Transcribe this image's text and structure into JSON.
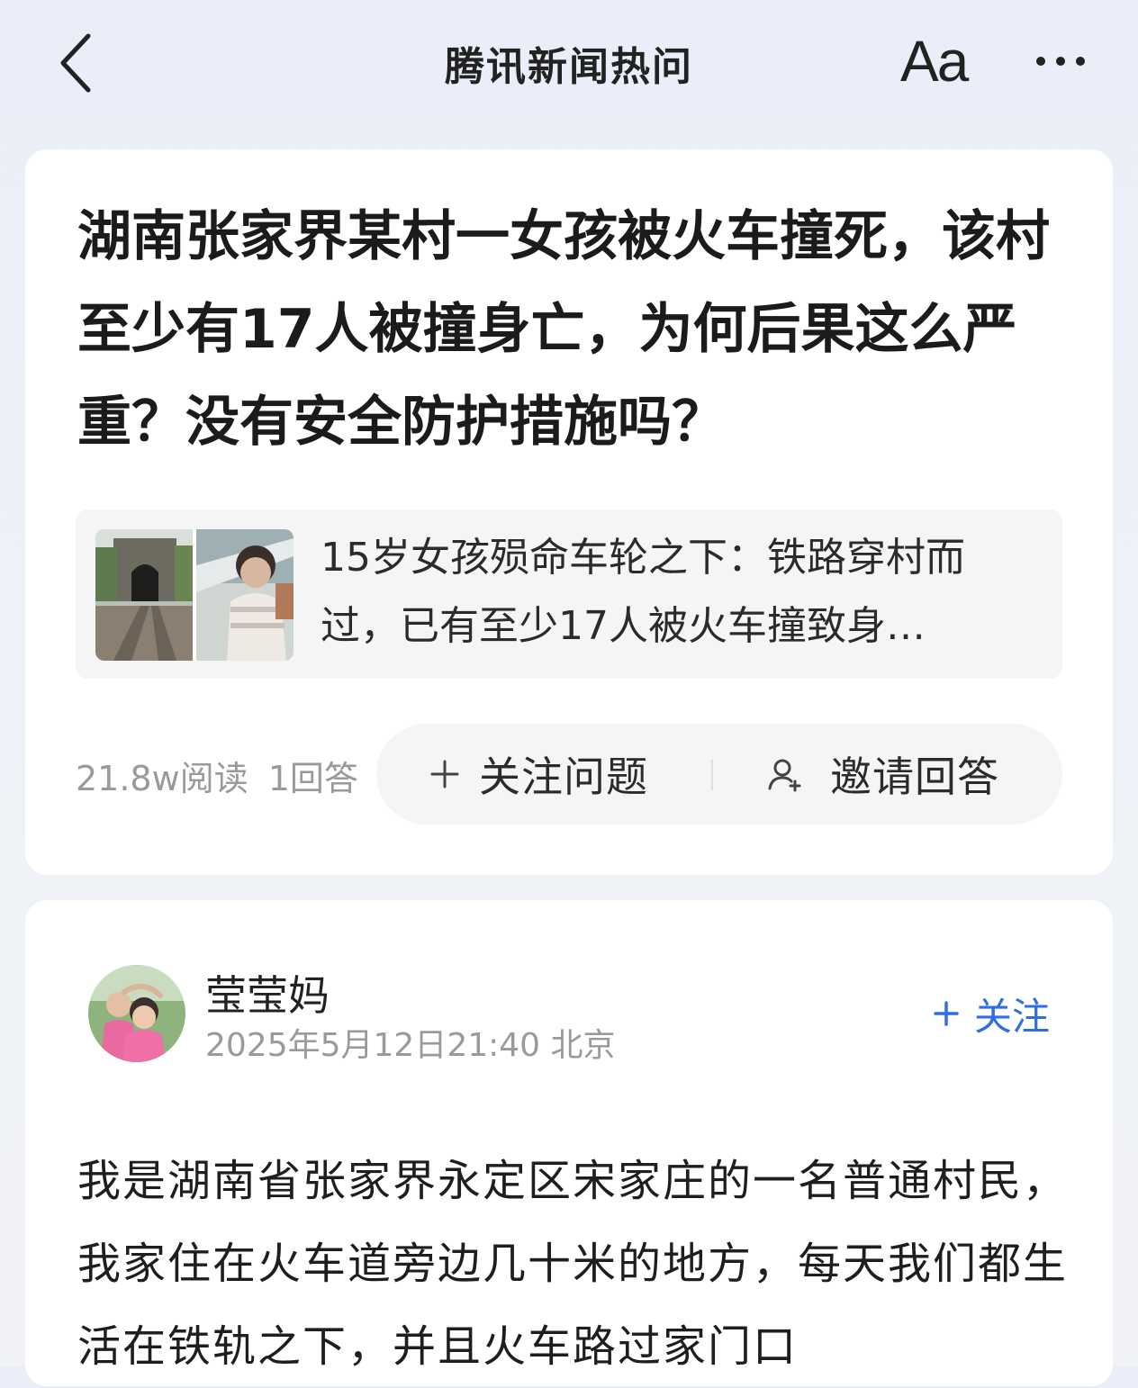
{
  "nav": {
    "title": "腾讯新闻热问",
    "font_label": "Aa"
  },
  "question": {
    "title": "湖南张家界某村一女孩被火车撞死，该村至少有17人被撞身亡，为何后果这么严重？没有安全防护措施吗？",
    "news": {
      "text": "15岁女孩殒命车轮之下：铁路穿村而过，已有至少17人被火车撞致身…"
    },
    "stats": {
      "reads": "21.8w阅读",
      "answers": "1回答"
    },
    "actions": {
      "follow_label": "关注问题",
      "invite_label": "邀请回答"
    }
  },
  "answer": {
    "author": "莹莹妈",
    "meta": "2025年5月12日21:40 北京",
    "follow_label": "关注",
    "body": "我是湖南省张家界永定区宋家庄的一名普通村民，我家住在火车道旁边几十米的地方，每天我们都生活在铁轨之下，并且火车路过家门口"
  },
  "colors": {
    "accent": "#2f6ee8",
    "background": "#eef1f7",
    "card": "#ffffff",
    "muted_text": "#9a9a9a"
  },
  "icons": {
    "back": "chevron-left-icon",
    "more": "more-dots-icon",
    "plus": "plus-icon",
    "invite": "add-person-icon"
  }
}
